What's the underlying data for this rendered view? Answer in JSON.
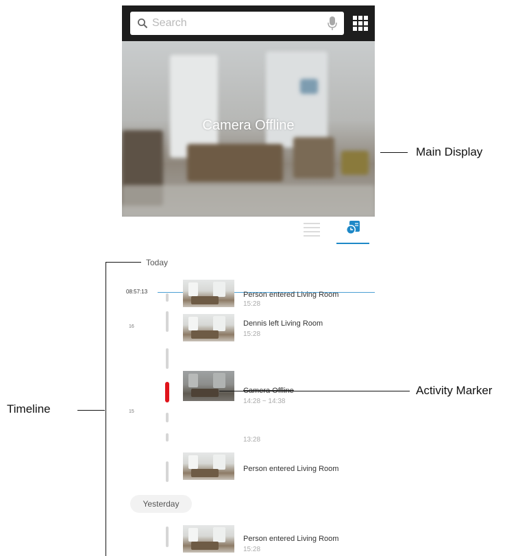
{
  "app": {
    "search": {
      "placeholder": "Search"
    },
    "main_display": {
      "status": "Camera Offline"
    },
    "view_toggle": {
      "active": "timeline"
    }
  },
  "timeline": {
    "current_time": "08:57:13",
    "tick_labels": [
      "16",
      "15"
    ],
    "day_today": "Today",
    "day_yesterday": "Yesterday",
    "events": [
      {
        "title": "Person entered Living Room",
        "time": "15:28"
      },
      {
        "title": "Dennis left Living Room",
        "time": "15:28"
      },
      {
        "title": "Camera Offline",
        "time": "14:28 ~ 14:38"
      },
      {
        "title": "",
        "time": "13:28"
      },
      {
        "title": "Person entered Living Room",
        "time": ""
      },
      {
        "title": "Person entered Living Room",
        "time": "15:28"
      }
    ]
  },
  "annotations": {
    "main_display": "Main Display",
    "activity_marker": "Activity Marker",
    "timeline": "Timeline"
  },
  "colors": {
    "accent": "#1e88c7",
    "activity_marker": "#e0141b",
    "top_bar": "#1d1d1d"
  }
}
